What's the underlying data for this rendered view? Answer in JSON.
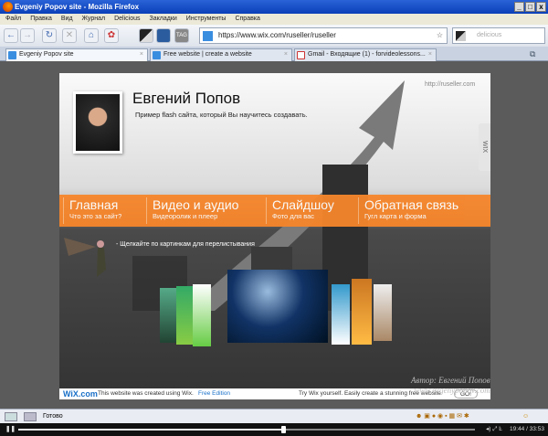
{
  "window": {
    "title": "Evgeniy Popov site - Mozilla Firefox",
    "controls": [
      "_",
      "□",
      "x"
    ]
  },
  "menu": [
    "Файл",
    "Правка",
    "Вид",
    "Журнал",
    "Delicious",
    "Закладки",
    "Инструменты",
    "Справка"
  ],
  "toolbar": {
    "url": "https://www.wix.com/ruseller/ruseller",
    "search_placeholder": "delicious"
  },
  "tabs": [
    {
      "label": "Evgeniy Popov site",
      "active": true
    },
    {
      "label": "Free website | create a website",
      "active": false
    },
    {
      "label": "Gmail - Входящие (1) - forvideolessons...",
      "active": false
    }
  ],
  "site": {
    "url_label": "http://ruseller.com",
    "name": "Евгений Попов",
    "tagline": "Пример flash сайта, который Вы научитесь создавать.",
    "wix_side": "WIX",
    "nav": [
      {
        "title": "Главная",
        "subtitle": "Что это за сайт?"
      },
      {
        "title": "Видео и аудио",
        "subtitle": "Видеоролик и плеер"
      },
      {
        "title": "Слайдшоу",
        "subtitle": "Фото для вас"
      },
      {
        "title": "Обратная связь",
        "subtitle": "Гугл карта и форма"
      }
    ],
    "hint": "- Щелкайте по картинкам для перелистывания",
    "accent": "#f7862b",
    "footer": {
      "logo": "WiX.com",
      "text": "This website was created using Wix.",
      "edition": "Free Edition",
      "promo": "Try Wix yourself. Easily create a stunning free website",
      "go": "GO!"
    }
  },
  "watermark": [
    "Автор: Евгений Попов",
    "www.evgenypopov.com"
  ],
  "status": {
    "text": "Готово"
  },
  "video": {
    "time": "19:44 / 33:53",
    "progress": 0.58
  }
}
